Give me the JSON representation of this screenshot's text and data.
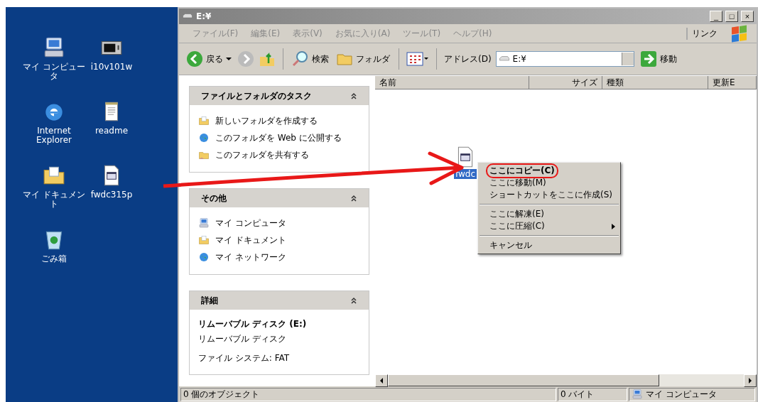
{
  "desktop": {
    "icons": [
      {
        "label": "マイ コンピュータ",
        "kind": "computer"
      },
      {
        "label": "i10v101w",
        "kind": "program"
      },
      {
        "label": "Internet Explorer",
        "kind": "browser"
      },
      {
        "label": "readme",
        "kind": "notepad"
      },
      {
        "label": "マイ ドキュメント",
        "kind": "folder"
      },
      {
        "label": "fwdc315p",
        "kind": "document"
      },
      {
        "label": "ごみ箱",
        "kind": "trash"
      }
    ]
  },
  "window": {
    "title": "E:¥",
    "buttons": [
      "_",
      "□",
      "×"
    ]
  },
  "menu_bar": {
    "items": [
      "ファイル(F)",
      "編集(E)",
      "表示(V)",
      "お気に入り(A)",
      "ツール(T)",
      "ヘルプ(H)"
    ],
    "links": "リンク"
  },
  "toolbar": {
    "back": "戻る",
    "search": "検索",
    "folders": "フォルダ",
    "address_label": "アドレス(D)",
    "address": "E:¥",
    "go": "移動"
  },
  "task_pane": {
    "panels": [
      {
        "title": "ファイルとフォルダのタスク",
        "items": [
          {
            "label": "新しいフォルダを作成する",
            "kind": "folder"
          },
          {
            "label": "このフォルダを Web に公開する",
            "kind": "globe"
          },
          {
            "label": "このフォルダを共有する",
            "kind": "share"
          }
        ]
      },
      {
        "title": "その他",
        "items": [
          {
            "label": "マイ コンピュータ",
            "kind": "computer"
          },
          {
            "label": "マイ ドキュメント",
            "kind": "documents"
          },
          {
            "label": "マイ ネットワーク",
            "kind": "network"
          }
        ]
      },
      {
        "title": "詳細",
        "details": {
          "name": "リムーバブル ディスク (E:)",
          "type": "リムーバブル ディスク",
          "filesystem": "ファイル システム: FAT"
        }
      }
    ]
  },
  "file_list": {
    "columns": [
      "名前",
      "サイズ",
      "種類",
      "更新E"
    ],
    "file": {
      "label": "fwdc",
      "selected": true
    }
  },
  "context_menu": {
    "items": [
      {
        "kind": "item",
        "label": "ここにコピー(C)",
        "default": true,
        "highlighted": true,
        "submenu": false
      },
      {
        "kind": "item",
        "label": "ここに移動(M)",
        "default": false,
        "highlighted": false,
        "submenu": false
      },
      {
        "kind": "item",
        "label": "ショートカットをここに作成(S)",
        "default": false,
        "highlighted": false,
        "submenu": false
      },
      {
        "kind": "separator"
      },
      {
        "kind": "item",
        "label": "ここに解凍(E)",
        "default": false,
        "highlighted": false,
        "submenu": false
      },
      {
        "kind": "item",
        "label": "ここに圧縮(C)",
        "default": false,
        "highlighted": false,
        "submenu": true
      },
      {
        "kind": "separator"
      },
      {
        "kind": "item",
        "label": "キャンセル",
        "default": false,
        "highlighted": false,
        "submenu": false
      }
    ]
  },
  "status_bar": {
    "objects": "0 個のオブジェクト",
    "size": "0 バイト",
    "location": "マイ コンピュータ"
  }
}
